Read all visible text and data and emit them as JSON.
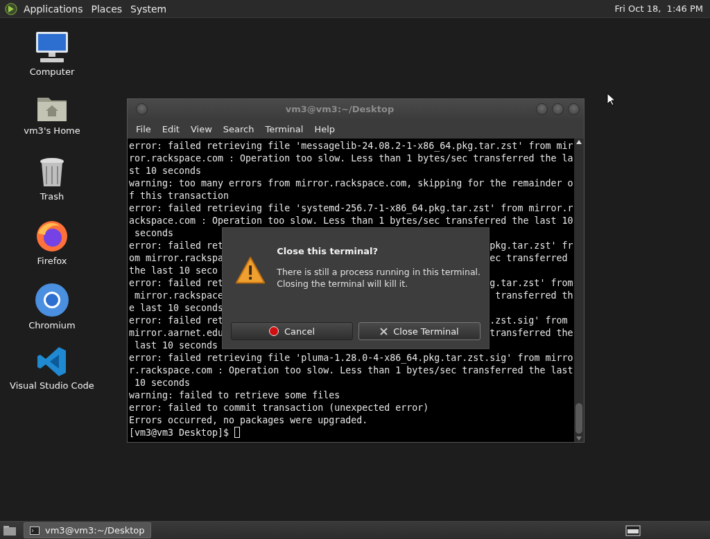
{
  "top_panel": {
    "menus": [
      "Applications",
      "Places",
      "System"
    ],
    "clock": "Fri Oct 18,  1:46 PM"
  },
  "desktop_icons": [
    {
      "label": "Computer",
      "kind": "computer"
    },
    {
      "label": "vm3's Home",
      "kind": "home"
    },
    {
      "label": "Trash",
      "kind": "trash"
    },
    {
      "label": "Firefox",
      "kind": "firefox"
    },
    {
      "label": "Chromium",
      "kind": "chromium"
    },
    {
      "label": "Visual Studio Code",
      "kind": "vscode"
    }
  ],
  "terminal": {
    "title": "vm3@vm3:~/Desktop",
    "menus": [
      "File",
      "Edit",
      "View",
      "Search",
      "Terminal",
      "Help"
    ],
    "lines": [
      {
        "text": "error: failed retrieving file 'messagelib-24.08.2-1-x86_64.pkg.tar.zst' from mir"
      },
      {
        "text": "ror.rackspace.com : Operation too slow. Less than 1 bytes/sec transferred the la"
      },
      {
        "text": "st 10 seconds"
      },
      {
        "text": "warning: too many errors from mirror.rackspace.com, skipping for the remainder o"
      },
      {
        "text": "f this transaction"
      },
      {
        "text": "error: failed retrieving file 'systemd-256.7-1-x86_64.pkg.tar.zst' from mirror.r"
      },
      {
        "text": "ackspace.com : Operation too slow. Less than 1 bytes/sec transferred the last 10"
      },
      {
        "text": " seconds"
      },
      {
        "left": "error: failed ret",
        "right": "pkg.tar.zst' fr"
      },
      {
        "left": "om mirror.rackspa",
        "right": "ec transferred"
      },
      {
        "text": "the last 10 seco"
      },
      {
        "left": "error: failed ret",
        "right": "g.tar.zst' from"
      },
      {
        "left": " mirror.rackspace",
        "right": " transferred th"
      },
      {
        "text": "e last 10 seconds"
      },
      {
        "left": "error: failed ret",
        "right": ".zst.sig' from"
      },
      {
        "left": "mirror.aarnet.edu",
        "right": "transferred the"
      },
      {
        "text": " last 10 seconds"
      },
      {
        "text": "error: failed retrieving file 'pluma-1.28.0-4-x86_64.pkg.tar.zst.sig' from mirro"
      },
      {
        "text": "r.rackspace.com : Operation too slow. Less than 1 bytes/sec transferred the last"
      },
      {
        "text": " 10 seconds"
      },
      {
        "text": "warning: failed to retrieve some files"
      },
      {
        "text": "error: failed to commit transaction (unexpected error)"
      },
      {
        "text": "Errors occurred, no packages were upgraded."
      }
    ],
    "prompt": "[vm3@vm3 Desktop]$ "
  },
  "dialog": {
    "title": "Close this terminal?",
    "message": "There is still a process running in this terminal.\nClosing the terminal will kill it.",
    "buttons": [
      {
        "label": "Cancel",
        "kind": "cancel"
      },
      {
        "label": "Close Terminal",
        "kind": "close"
      }
    ]
  },
  "taskbar": {
    "tasks": [
      {
        "label": "vm3@vm3:~/Desktop"
      }
    ]
  }
}
